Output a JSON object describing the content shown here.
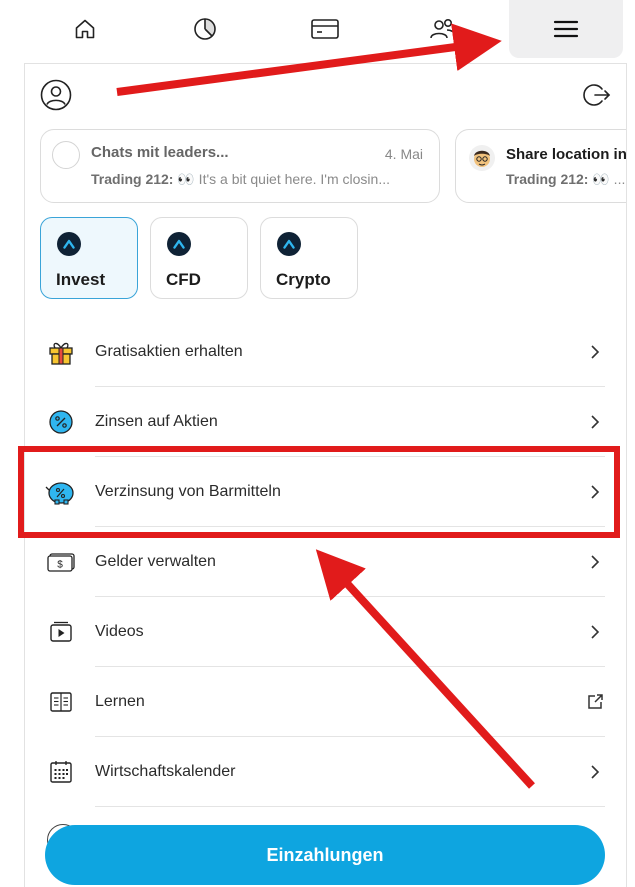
{
  "nav": {
    "items": [
      "home",
      "portfolio",
      "cards",
      "community",
      "menu"
    ],
    "active": "menu"
  },
  "cards": [
    {
      "title": "Chats mit leaders...",
      "date": "4. Mai",
      "sender": "Trading 212:",
      "message": "👀 It's a bit quiet here. I'm closin..."
    },
    {
      "title": "Share location in",
      "sender": "Trading 212:",
      "message": "👀 ..."
    }
  ],
  "accounts": [
    {
      "label": "Invest",
      "active": true
    },
    {
      "label": "CFD",
      "active": false
    },
    {
      "label": "Crypto",
      "active": false
    }
  ],
  "menu": [
    {
      "label": "Gratisaktien erhalten",
      "icon": "gift-icon",
      "action": "chevron"
    },
    {
      "label": "Zinsen auf Aktien",
      "icon": "percent-coin-icon",
      "action": "chevron"
    },
    {
      "label": "Verzinsung von Barmitteln",
      "icon": "piggy-bank-icon",
      "action": "chevron"
    },
    {
      "label": "Gelder verwalten",
      "icon": "banknote-icon",
      "action": "chevron"
    },
    {
      "label": "Videos",
      "icon": "video-icon",
      "action": "chevron"
    },
    {
      "label": "Lernen",
      "icon": "book-icon",
      "action": "external"
    },
    {
      "label": "Wirtschaftskalender",
      "icon": "calendar-icon",
      "action": "chevron"
    }
  ],
  "deposit_button": "Einzahlungen",
  "colors": {
    "accent": "#0ea5e0",
    "annotation": "#e11b1b",
    "active_account_bg": "#eef8fd"
  }
}
